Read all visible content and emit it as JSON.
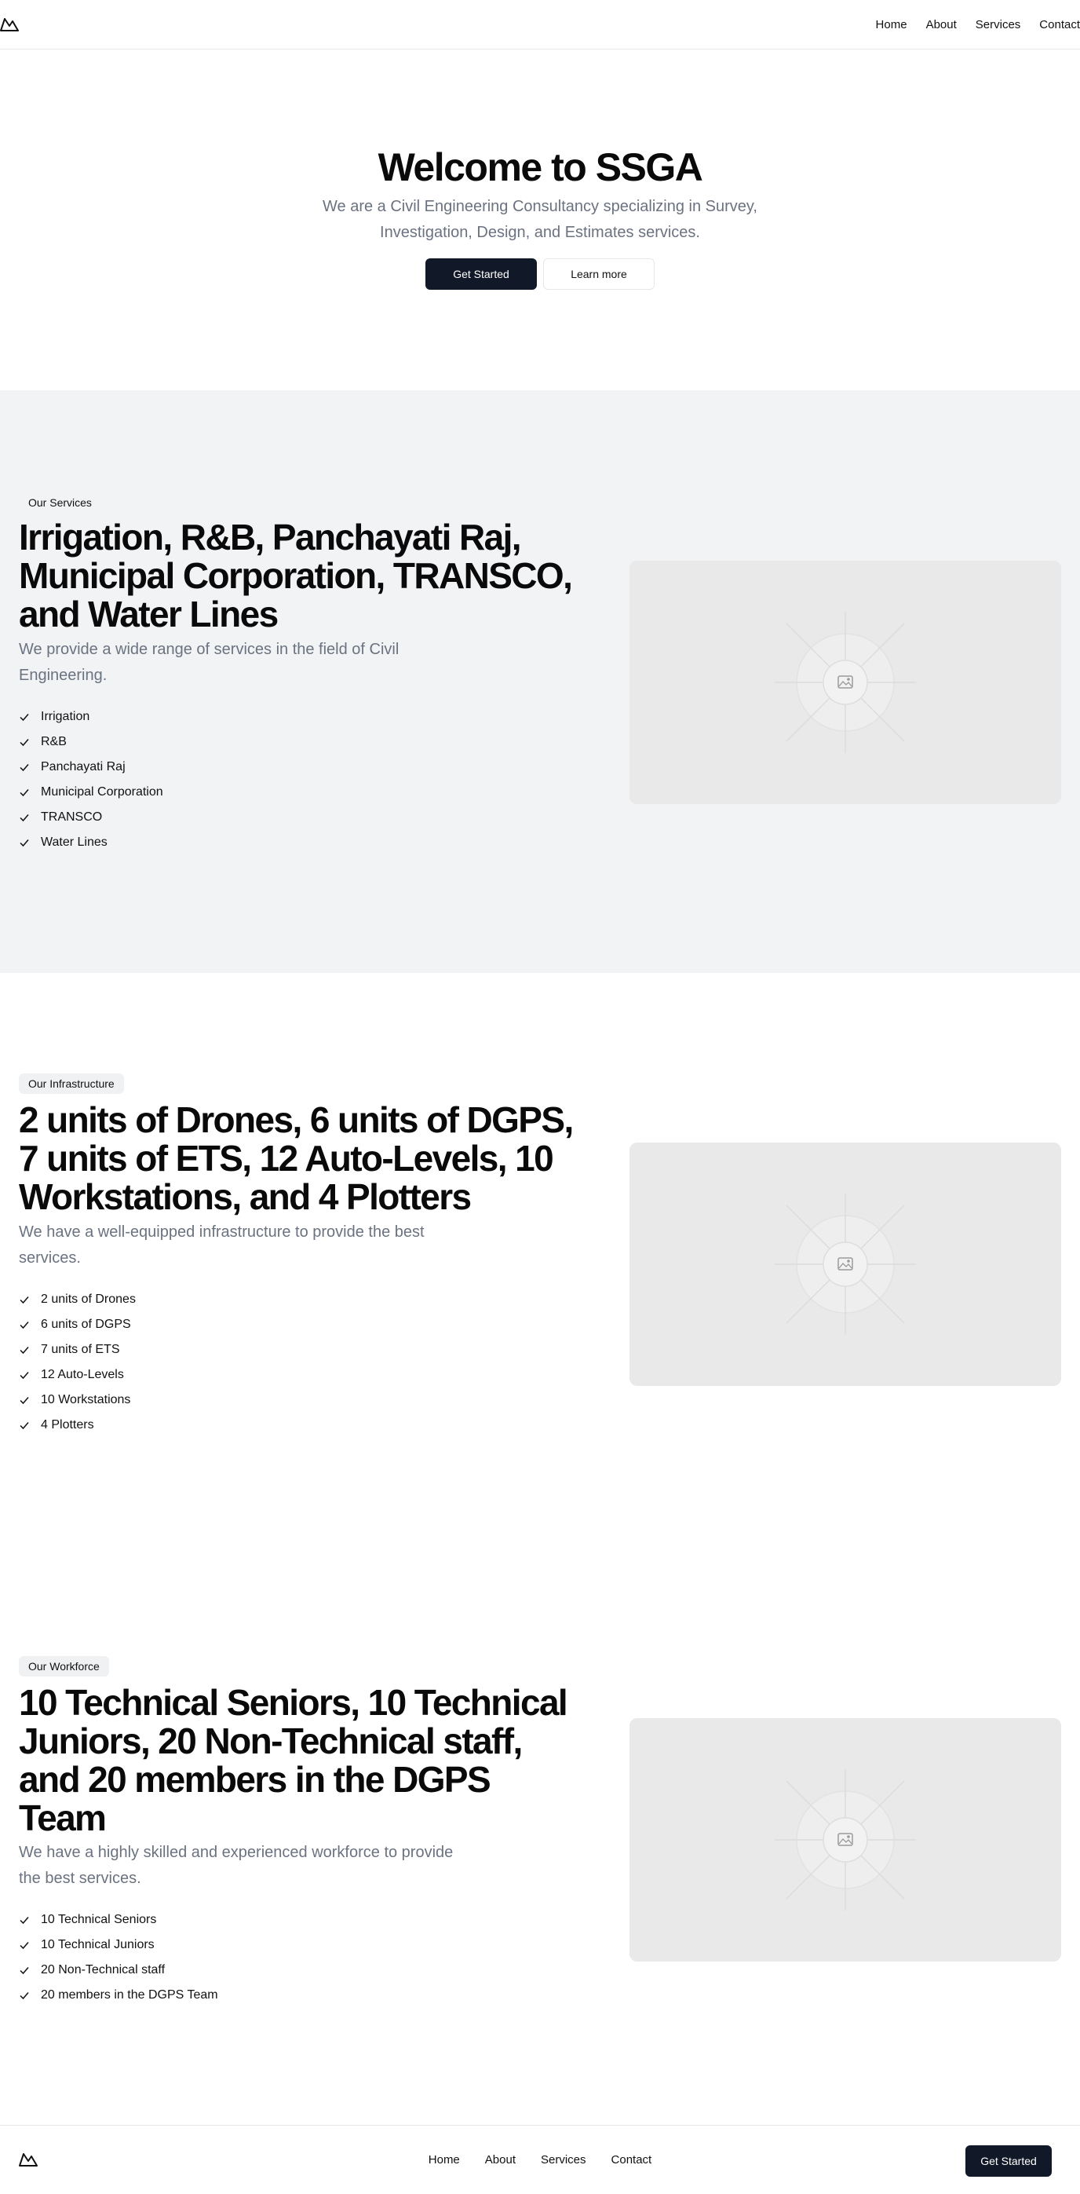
{
  "header": {
    "nav": [
      "Home",
      "About",
      "Services",
      "Contact"
    ]
  },
  "hero": {
    "title": "Welcome to SSGA",
    "subtitle_line1": "We are a Civil Engineering Consultancy specializing in Survey,",
    "subtitle_line2": "Investigation, Design, and Estimates services.",
    "primary_button": "Get Started",
    "secondary_button": "Learn more"
  },
  "services": {
    "badge": "Our Services",
    "title_line1": "Irrigation, R&B, Panchayati Raj,",
    "title_line2": "Municipal Corporation, TRANSCO,",
    "title_line3": "and Water Lines",
    "desc_line1": "We provide a wide range of services in the field of Civil",
    "desc_line2": "Engineering.",
    "items": [
      "Irrigation",
      "R&B",
      "Panchayati Raj",
      "Municipal Corporation",
      "TRANSCO",
      "Water Lines"
    ]
  },
  "infrastructure": {
    "badge": "Our Infrastructure",
    "title_line1": "2 units of Drones, 6 units of DGPS,",
    "title_line2": "7 units of ETS, 12 Auto-Levels, 10",
    "title_line3": "Workstations, and 4 Plotters",
    "desc_line1": "We have a well-equipped infrastructure to provide the best",
    "desc_line2": "services.",
    "items": [
      "2 units of Drones",
      "6 units of DGPS",
      "7 units of ETS",
      "12 Auto-Levels",
      "10 Workstations",
      "4 Plotters"
    ]
  },
  "workforce": {
    "badge": "Our Workforce",
    "title_line1": "10 Technical Seniors, 10 Technical",
    "title_line2": "Juniors, 20 Non-Technical staff,",
    "title_line3": "and 20 members in the DGPS",
    "title_line4": "Team",
    "desc_line1": "We have a highly skilled and experienced workforce to provide",
    "desc_line2": "the best services.",
    "items": [
      "10 Technical Seniors",
      "10 Technical Juniors",
      "20 Non-Technical staff",
      "20 members in the DGPS Team"
    ]
  },
  "footer": {
    "nav": [
      "Home",
      "About",
      "Services",
      "Contact"
    ],
    "button": "Get Started"
  },
  "icons": {
    "logo": "mountain-logo-icon",
    "check": "check-icon",
    "placeholder": "image-placeholder-icon"
  }
}
